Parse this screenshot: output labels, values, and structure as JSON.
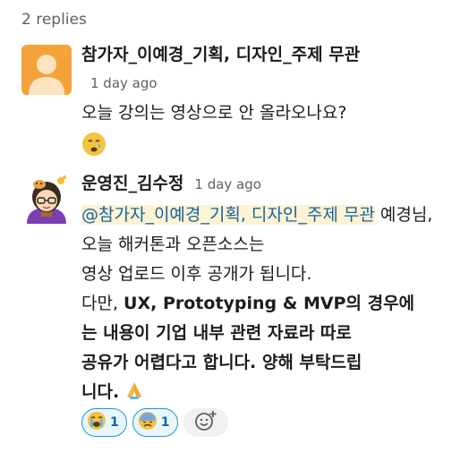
{
  "thread": {
    "replies_count": "2 replies"
  },
  "messages": [
    {
      "author": "참가자_이예경_기획, 디자인_주제 무관",
      "time": "1 day ago",
      "text": "오늘 강의는 영상으로 안 올라오나요?",
      "emoji": "crying-face",
      "avatar_color": "#f4a33a"
    },
    {
      "author": "운영진_김수정",
      "time": "1 day ago",
      "mention": "@참가자_이예경_기획, 디자인_주제 무관",
      "text_line1": " 예경님, 오늘 해커톤과 오픈소스는",
      "text_line2": "영상 업로드 이후 공개가 됩니다.",
      "text_line3_plain_a": "다만, ",
      "text_line3_bold": "UX, Prototyping & MVP",
      "text_line3_plain_b": "의 경우에",
      "text_line4": "는 내용이 기업 내부 관련 자료라 따로",
      "text_line5": "공유가 어렵다고 합니다. 양해 부탁드립",
      "text_line6": "니다.",
      "trailing_emoji": "folded-hands",
      "avatar_bg": "#7b3fb5"
    }
  ],
  "reactions": [
    {
      "emoji": "loudly-crying-face",
      "count": "1"
    },
    {
      "emoji": "downcast-face-with-sweat",
      "count": "1"
    }
  ],
  "add_reaction_icon": "add-reaction-icon",
  "colors": {
    "mention_bg": "#fdf2d2",
    "mention_text": "#1264a3",
    "reaction_border": "#1d9bd1",
    "reaction_bg": "#e8f5fa"
  }
}
